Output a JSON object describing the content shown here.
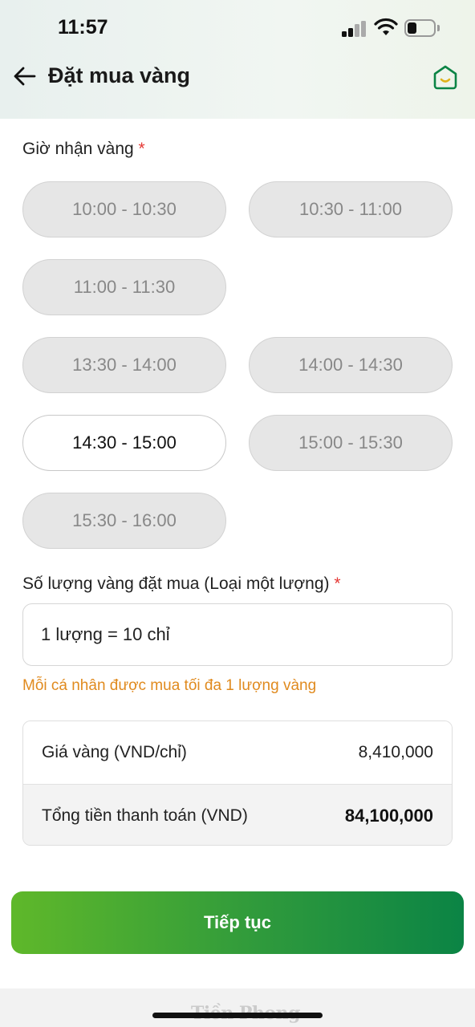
{
  "status_bar": {
    "time": "11:57"
  },
  "header": {
    "title": "Đặt mua vàng"
  },
  "time_section": {
    "label": "Giờ nhận vàng",
    "required_mark": "*",
    "slots": [
      {
        "label": "10:00 - 10:30",
        "selected": false
      },
      {
        "label": "10:30 - 11:00",
        "selected": false
      },
      {
        "label": "11:00 - 11:30",
        "selected": false
      },
      {
        "label": "13:30 - 14:00",
        "selected": false
      },
      {
        "label": "14:00 - 14:30",
        "selected": false
      },
      {
        "label": "14:30 - 15:00",
        "selected": true
      },
      {
        "label": "15:00 - 15:30",
        "selected": false
      },
      {
        "label": "15:30 - 16:00",
        "selected": false
      }
    ]
  },
  "quantity_section": {
    "label": "Số lượng vàng đặt mua (Loại một lượng)",
    "required_mark": "*",
    "value": "1 lượng = 10 chỉ",
    "limit_note": "Mỗi cá nhân được mua tối đa 1 lượng vàng"
  },
  "price_box": {
    "unit_price_label": "Giá vàng (VND/chỉ)",
    "unit_price_value": "8,410,000",
    "total_label": "Tổng tiền thanh toán (VND)",
    "total_value": "84,100,000"
  },
  "continue_button": {
    "label": "Tiếp tục"
  },
  "watermark": {
    "text": "Tiền Phong"
  },
  "colors": {
    "accent_green": "#0b8445",
    "light_green": "#5fb82a",
    "required_red": "#e53935",
    "note_orange": "#e08a1e"
  },
  "icons": {
    "back": "arrow-left-icon",
    "home": "home-icon",
    "signal": "cellular-signal-icon",
    "wifi": "wifi-icon",
    "battery": "battery-icon"
  }
}
